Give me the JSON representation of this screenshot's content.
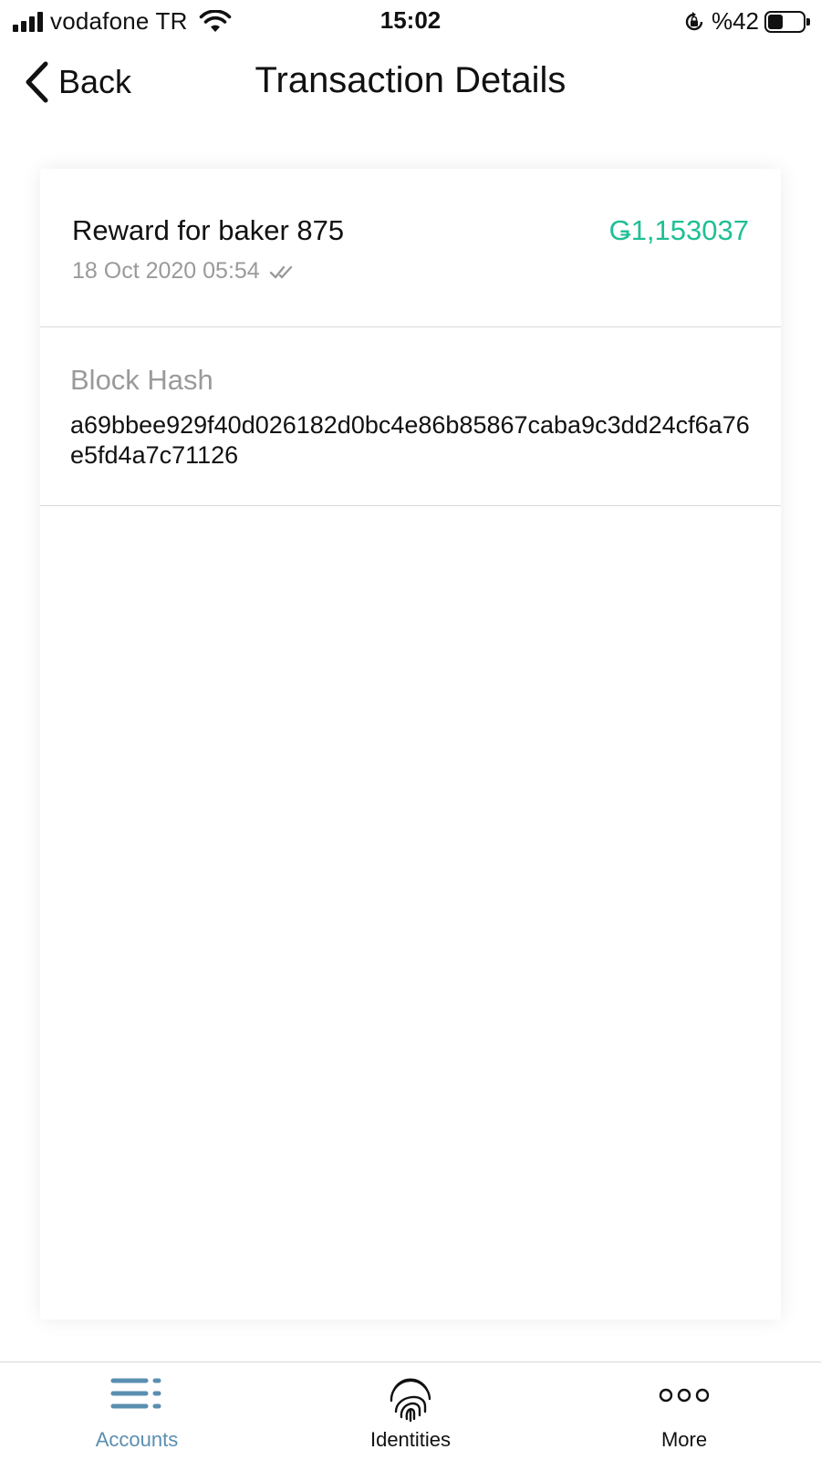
{
  "status_bar": {
    "carrier": "vodafone TR",
    "time": "15:02",
    "battery_percent": "%42",
    "battery_level": 0.42
  },
  "nav": {
    "back_label": "Back",
    "title": "Transaction Details"
  },
  "transaction": {
    "title": "Reward for baker 875",
    "amount": "Ǥ1,153037",
    "amount_color": "#1fbf95",
    "date": "18 Oct 2020 05:54",
    "status_icon": "double-check-icon"
  },
  "block_hash": {
    "label": "Block Hash",
    "value": "a69bbee929f40d026182d0bc4e86b85867caba9c3dd24cf6a76e5fd4a7c71126"
  },
  "tab_bar": {
    "active_color": "#5a8fb0",
    "tabs": [
      {
        "label": "Accounts",
        "icon": "accounts-list-icon",
        "active": true
      },
      {
        "label": "Identities",
        "icon": "fingerprint-icon",
        "active": false
      },
      {
        "label": "More",
        "icon": "more-dots-icon",
        "active": false
      }
    ]
  }
}
